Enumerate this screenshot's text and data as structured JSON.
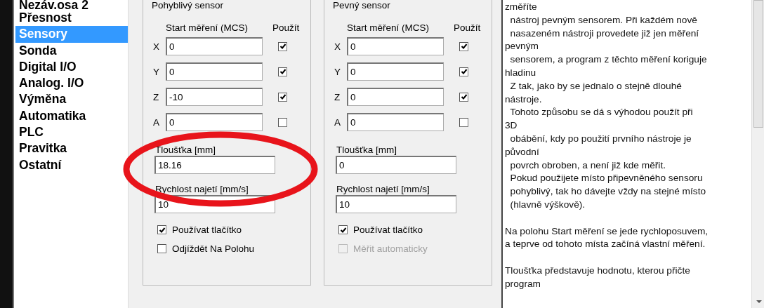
{
  "nav": {
    "items": [
      {
        "label": "Nezáv.osa 2",
        "selected": false
      },
      {
        "label": "Přesnost",
        "selected": false
      },
      {
        "label": "Sensory",
        "selected": true
      },
      {
        "label": "Sonda",
        "selected": false
      },
      {
        "label": "Digital I/O",
        "selected": false
      },
      {
        "label": "Analog. I/O",
        "selected": false
      },
      {
        "label": "Výměna",
        "selected": false
      },
      {
        "label": "Automatika",
        "selected": false
      },
      {
        "label": "PLC",
        "selected": false
      },
      {
        "label": "Pravitka",
        "selected": false
      },
      {
        "label": "Ostatní",
        "selected": false
      }
    ]
  },
  "groups": [
    {
      "title": "Pohyblivý sensor",
      "start_label": "Start měření (MCS)",
      "use_label": "Použít",
      "axes": [
        {
          "axis": "X",
          "value": "0",
          "checked": true
        },
        {
          "axis": "Y",
          "value": "0",
          "checked": true
        },
        {
          "axis": "Z",
          "value": "-10",
          "checked": true
        },
        {
          "axis": "A",
          "value": "0",
          "checked": false
        }
      ],
      "thickness_label": "Tloušťka [mm]",
      "thickness": "18.16",
      "speed_label": "Rychlost najetí [mm/s]",
      "speed": "10",
      "options": [
        {
          "label": "Používat tlačítko",
          "checked": true,
          "disabled": false
        },
        {
          "label": "Odjíždět Na Polohu",
          "checked": false,
          "disabled": false
        }
      ],
      "highlighted": true
    },
    {
      "title": "Pevný sensor",
      "start_label": "Start měření (MCS)",
      "use_label": "Použít",
      "axes": [
        {
          "axis": "X",
          "value": "0",
          "checked": true
        },
        {
          "axis": "Y",
          "value": "0",
          "checked": true
        },
        {
          "axis": "Z",
          "value": "0",
          "checked": true
        },
        {
          "axis": "A",
          "value": "0",
          "checked": false
        }
      ],
      "thickness_label": "Tloušťka [mm]",
      "thickness": "0",
      "speed_label": "Rychlost najetí [mm/s]",
      "speed": "10",
      "options": [
        {
          "label": "Používat tlačítko",
          "checked": true,
          "disabled": false
        },
        {
          "label": "Měřit automaticky",
          "checked": false,
          "disabled": true
        }
      ],
      "highlighted": false
    }
  ],
  "help": {
    "paragraphs": [
      [
        "změříte",
        "  nástroj pevným sensorem. Při každém nově",
        "  nasazeném nástroji provedete již jen měření",
        "pevným",
        "  sensorem, a program z těchto měření koriguje",
        "hladinu",
        "  Z tak, jako by se jednalo o stejně dlouhé",
        "nástroje.",
        "  Tohoto způsobu se dá s výhodou použít při",
        "3D",
        "  obábění, kdy po použití prvního nástroje je",
        "původní",
        "  povrch obroben, a není již kde měřit.",
        "  Pokud použijete místo připevněného sensoru",
        "  pohyblivý, tak ho dávejte vždy na stejné místo",
        "  (hlavně výškově)."
      ],
      [
        "Na polohu Start měření se jede rychloposuvem,",
        "a teprve od tohoto místa začíná vlastní měření."
      ],
      [
        "Tloušťka představuje hodnotu, kterou přičte",
        "program"
      ]
    ]
  }
}
